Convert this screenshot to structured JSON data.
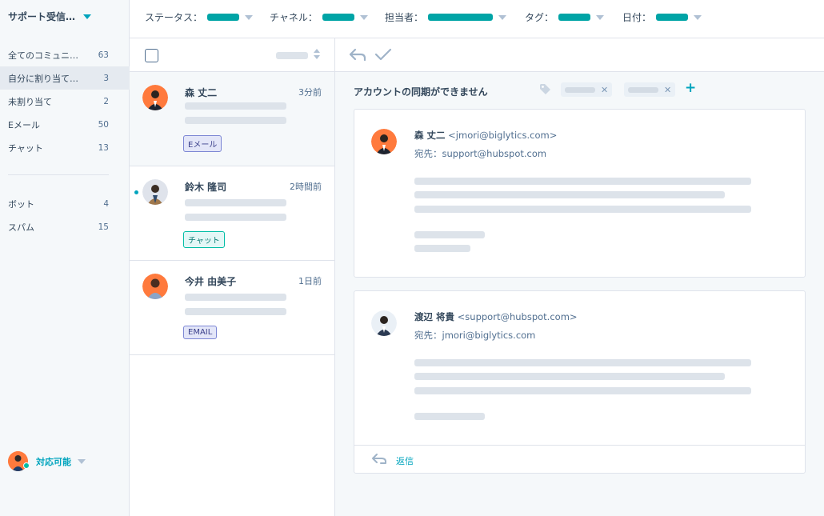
{
  "sidebar": {
    "inbox_title": "サポート受信…",
    "items": [
      {
        "label": "全てのコミュニ…",
        "count": "63"
      },
      {
        "label": "自分に割り当て…",
        "count": "3"
      },
      {
        "label": "未割り当て",
        "count": "2"
      },
      {
        "label": "Eメール",
        "count": "50"
      },
      {
        "label": "チャット",
        "count": "13"
      }
    ],
    "items2": [
      {
        "label": "ボット",
        "count": "4"
      },
      {
        "label": "スパム",
        "count": "15"
      }
    ],
    "status_label": "対応可能",
    "status_icon": "avatar-orange"
  },
  "filters": {
    "status": "ステータス：",
    "channel": "チャネル：",
    "owner": "担当者：",
    "tag": "タグ：",
    "date": "日付："
  },
  "conversations": [
    {
      "name": "森 丈二",
      "time": "3分前",
      "badge": "Eメール",
      "badge_type": "email",
      "unread": false
    },
    {
      "name": "鈴木 隆司",
      "time": "2時間前",
      "badge": "チャット",
      "badge_type": "chat",
      "unread": true
    },
    {
      "name": "今井 由美子",
      "time": "1日前",
      "badge": "EMAIL",
      "badge_type": "email",
      "unread": false
    }
  ],
  "detail": {
    "subject": "アカウントの同期ができません",
    "messages": [
      {
        "sender": "森 丈二",
        "address": "<jmori@biglytics.com>",
        "to": "宛先：support@hubspot.com"
      },
      {
        "sender": "渡辺 将貴",
        "address": "<support@hubspot.com>",
        "to": "宛先：jmori@biglytics.com"
      }
    ],
    "reply_label": "返信"
  },
  "colors": {
    "accent": "#00a4bd",
    "teal_filter": "#00a4a6",
    "avatar_orange": "#ff7a3d",
    "avatar_gray": "#dfe3eb"
  }
}
